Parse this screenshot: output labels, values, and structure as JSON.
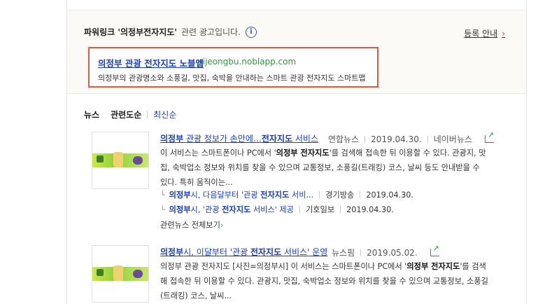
{
  "ad": {
    "label_bold": "파워링크 '의정부전자지도'",
    "label_rest": "관련 광고입니다.",
    "info_icon": "info-icon",
    "register": "등록 안내",
    "register_chevron": "›",
    "title": "의정부 관광 전자지도 노블앱",
    "url": "uijeongbu.noblapp.com",
    "desc": "의정부의 관광명소와 소풍길, 맛집, 숙박을 안내하는 스마트 관광 전자지도 스마트맵"
  },
  "tabs": {
    "news": "뉴스",
    "relevance": "관련도순",
    "latest": "최신순"
  },
  "articles": [
    {
      "title_bold_1": "의정부",
      "title_mid": " 관광 정보가 손안에…",
      "title_bold_2": "전자지도",
      "title_end": " 서비스",
      "press": "연합뉴스",
      "date": "2019.04.30.",
      "extra": "네이버뉴스",
      "body_1": "이 서비스는 스마트폰이나 PC에서 '",
      "body_bold": "의정부 전자지도",
      "body_2": "'를 검색해 접속한 뒤 이용할 수 있다. 관광지, 맛집, 숙박업소 정보와 위치를 찾을 수 있으며 교통정보, 소풍길(트래킹) 코스, 날씨 등도 안내받을 수 있다. 특히 움직이는...",
      "related": [
        {
          "bold": "의정부",
          "mid": "시, 다음달부터 '관광 ",
          "bold2": "전자지도",
          "end": " 서비...",
          "press": "경기방송",
          "date": "2019.04.30."
        },
        {
          "bold": "의정부",
          "mid": "시, '관광 ",
          "bold2": "전자지도",
          "end": " 서비스' 제공",
          "press": "기호일보",
          "date": "2019.04.30."
        }
      ],
      "more": "관련뉴스 전체보기",
      "more_arrow": "›"
    },
    {
      "title_bold_1": "의정부",
      "title_mid": "시, 이달부터 '관광 ",
      "title_bold_2": "전자지도",
      "title_end": " 서비스' 운영",
      "press": "뉴스핌",
      "date": "2019.05.02.",
      "body_1": "의정부 관광 전자지도 [사진=의정부시] 이 서비스는 스마트폰이나 PC에서 '",
      "body_bold": "의정부 전자지도",
      "body_2": "'를 검색해 접속한 뒤 이용할 수 있다. 관광지, 맛집, 숙박업소 정보와 위치를 찾을 수 있으며 교통정보, 소풍길(트래킹) 코스, 날씨..."
    }
  ],
  "colors": {
    "link": "#1a3fb5",
    "url": "#2f9a3c",
    "highlight_border": "#e05a45"
  }
}
